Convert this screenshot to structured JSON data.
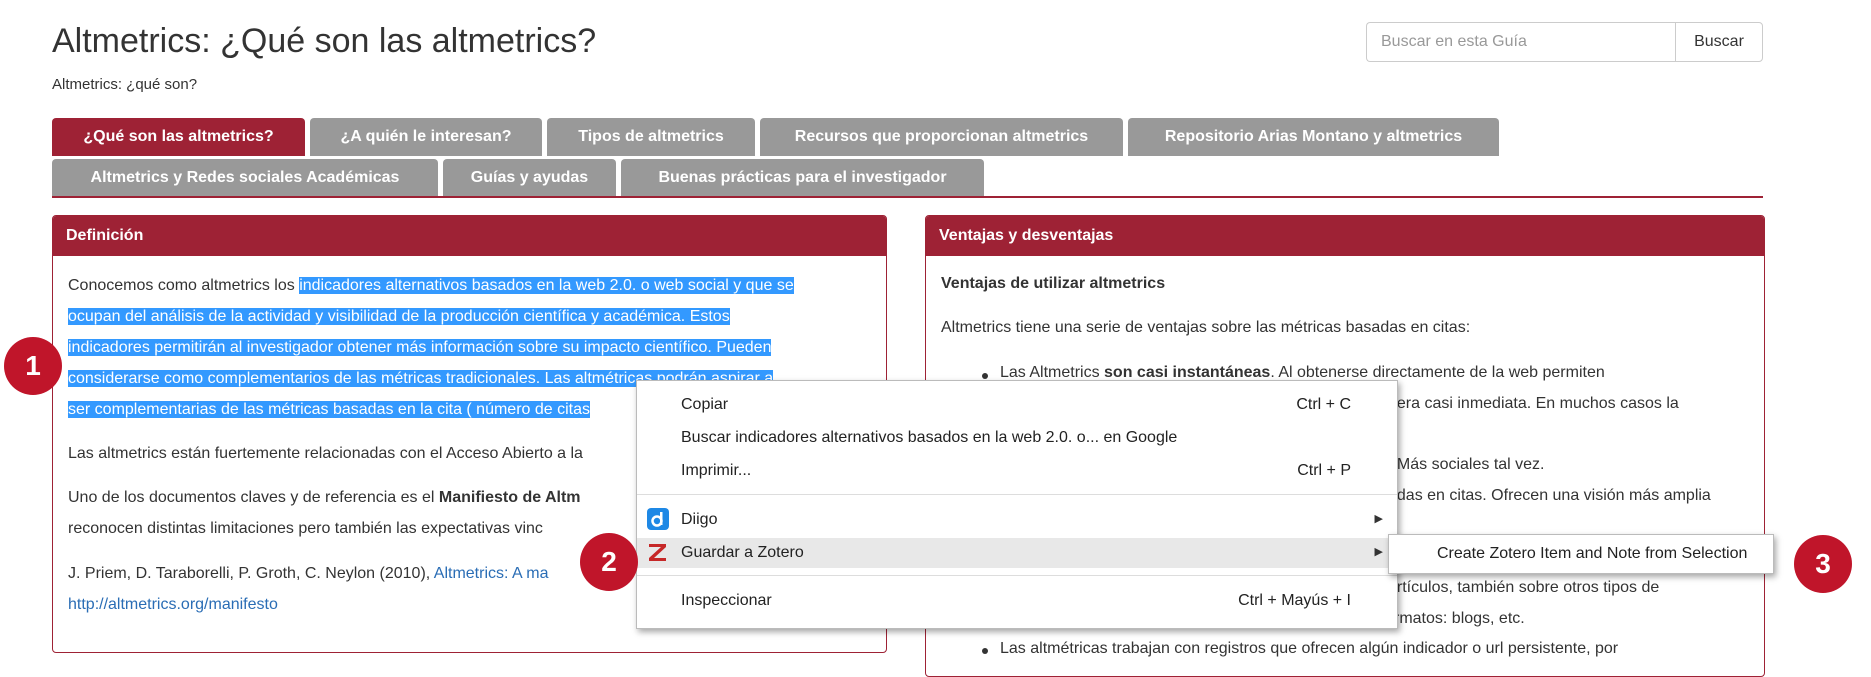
{
  "header": {
    "title": "Altmetrics: ¿Qué son las altmetrics?",
    "subtitle": "Altmetrics: ¿qué son?",
    "search_placeholder": "Buscar en esta Guía",
    "search_button": "Buscar"
  },
  "tabs": [
    {
      "label": "¿Qué son las altmetrics?",
      "active": true
    },
    {
      "label": "¿A quién le interesan?",
      "active": false
    },
    {
      "label": "Tipos de altmetrics",
      "active": false
    },
    {
      "label": "Recursos que proporcionan altmetrics",
      "active": false
    },
    {
      "label": "Repositorio Arias Montano y altmetrics",
      "active": false
    },
    {
      "label": "Altmetrics y Redes sociales Académicas",
      "active": false
    },
    {
      "label": "Guías y ayudas",
      "active": false
    },
    {
      "label": "Buenas prácticas para el investigador",
      "active": false
    }
  ],
  "left_panel": {
    "title": "Definición",
    "p1_prefix": "Conocemos como altmetrics los ",
    "p1_sel1": "indicadores alternativos basados en la web 2.0. o web social y que se",
    "p1_sel2": "ocupan del análisis de la actividad y visibilidad de la producción científica y académica. Estos",
    "p1_sel3": "indicadores permitirán al investigador obtener más información sobre su impacto científico. Pueden",
    "p1_sel4": "considerarse como complementarios de las métricas tradicionales. Las altmétricas podrán aspirar a",
    "p1_sel5": "ser complementarias de las métricas basadas en la cita ( número de citas",
    "p2": "Las altmetrics están fuertemente relacionadas con el Acceso Abierto a la",
    "p3_prefix": "Uno de los documentos claves y de referencia es el ",
    "p3_bold": "Manifiesto de Altm",
    "p3_line2": "reconocen distintas limitaciones pero también las expectativas vinc",
    "cite_prefix": "J. Priem, D. Taraborelli, P. Groth, C. Neylon (2010), ",
    "cite_link": "Altmetrics: A ma",
    "cite_url": "http://altmetrics.org/manifesto"
  },
  "right_panel": {
    "title": "Ventajas y desventajas",
    "subheading": "Ventajas de utilizar altmetrics",
    "intro": "Altmetrics tiene una serie de ventajas sobre las métricas basadas en citas:",
    "b1_prefix": "Las Altmetrics ",
    "b1_bold": "son casi instantáneas",
    "b1_rest": ". Al obtenerse directamente de la web permiten",
    "b1_line2": "nera casi inmediata. En muchos casos la",
    "b2_frag": ". Más sociales tal vez.",
    "b3_frag": "adas en citas. Ofrecen una visión más amplia",
    "b4_frag": "artículos, también sobre otros tipos de",
    "b4_line2": "contenidos: data, software, etc. Así como otro tipo de formatos: blogs, etc.",
    "b5": "Las altmétricas trabajan con registros que ofrecen algún indicador o url persistente, por"
  },
  "context_menu": {
    "copy": "Copiar",
    "copy_shortcut": "Ctrl + C",
    "search_google": "Buscar indicadores alternativos basados en la web 2.0. o... en Google",
    "print": "Imprimir...",
    "print_shortcut": "Ctrl + P",
    "diigo": "Diigo",
    "zotero": "Guardar a Zotero",
    "inspect": "Inspeccionar",
    "inspect_shortcut": "Ctrl + Mayús + I",
    "submenu_item": "Create Zotero Item and Note from Selection"
  },
  "callouts": [
    "1",
    "2",
    "3"
  ],
  "colors": {
    "brand": "#9e2235",
    "tab_inactive": "#999999",
    "selection": "#3399ff",
    "callout": "#c0152a"
  }
}
